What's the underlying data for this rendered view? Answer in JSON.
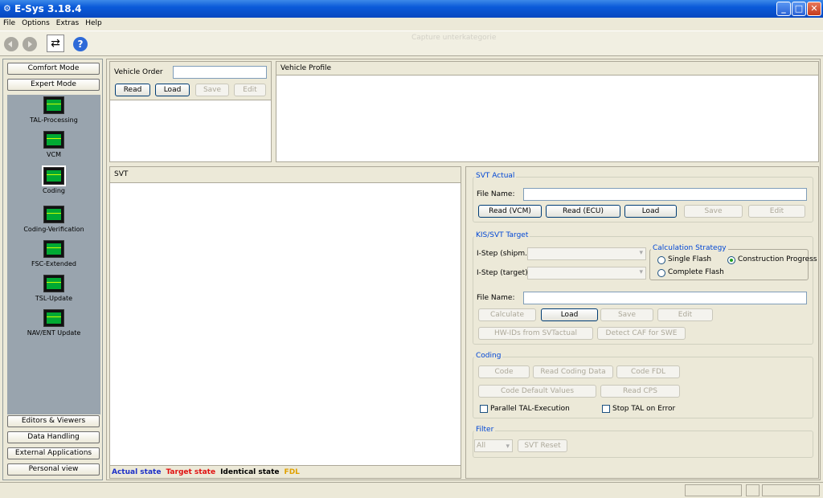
{
  "window": {
    "title": "E-Sys 3.18.4"
  },
  "menu": [
    "File",
    "Options",
    "Extras",
    "Help"
  ],
  "toolbar": {
    "ghost_text": "Capture unterkategorie"
  },
  "left": {
    "top_buttons": [
      "Comfort Mode",
      "Expert Mode"
    ],
    "nav_items": [
      "TAL-Processing",
      "VCM",
      "Coding",
      "Coding-Verification",
      "FSC-Extended",
      "TSL-Update",
      "NAV/ENT Update"
    ],
    "bottom_buttons": [
      "Editors & Viewers",
      "Data Handling",
      "External Applications",
      "Personal view"
    ]
  },
  "vehicle_order": {
    "label": "Vehicle Order",
    "value": "",
    "buttons": [
      "Read",
      "Load",
      "Save",
      "Edit"
    ]
  },
  "vehicle_profile": {
    "label": "Vehicle Profile"
  },
  "svt": {
    "label": "SVT",
    "legend": [
      {
        "text": "Actual state",
        "color": "#1c2fc8"
      },
      {
        "text": "Target state",
        "color": "#e01010"
      },
      {
        "text": "Identical state",
        "color": "#000000"
      },
      {
        "text": "FDL",
        "color": "#e0a000"
      }
    ]
  },
  "svt_actual": {
    "title": "SVT Actual",
    "file_label": "File Name:",
    "file_value": "",
    "buttons": [
      "Read (VCM)",
      "Read (ECU)",
      "Load",
      "Save",
      "Edit"
    ]
  },
  "kis": {
    "title": "KIS/SVT Target",
    "istep_shipm": "I-Step (shipm.):",
    "istep_target": "I-Step (target):",
    "file_label": "File Name:",
    "buttons": [
      "Calculate",
      "Load",
      "Save",
      "Edit"
    ],
    "buttons2": [
      "HW-IDs from SVTactual",
      "Detect CAF for SWE"
    ],
    "strategy": {
      "title": "Calculation Strategy",
      "options": [
        "Single Flash",
        "Construction Progress",
        "Complete Flash"
      ],
      "selected": "Construction Progress"
    }
  },
  "coding": {
    "title": "Coding",
    "row1": [
      "Code",
      "Read Coding Data",
      "Code FDL"
    ],
    "row2": [
      "Code Default Values",
      "Read CPS"
    ],
    "checks": [
      "Parallel TAL-Execution",
      "Stop TAL on Error"
    ]
  },
  "filter": {
    "title": "Filter",
    "select_value": "All",
    "reset_label": "SVT Reset"
  }
}
